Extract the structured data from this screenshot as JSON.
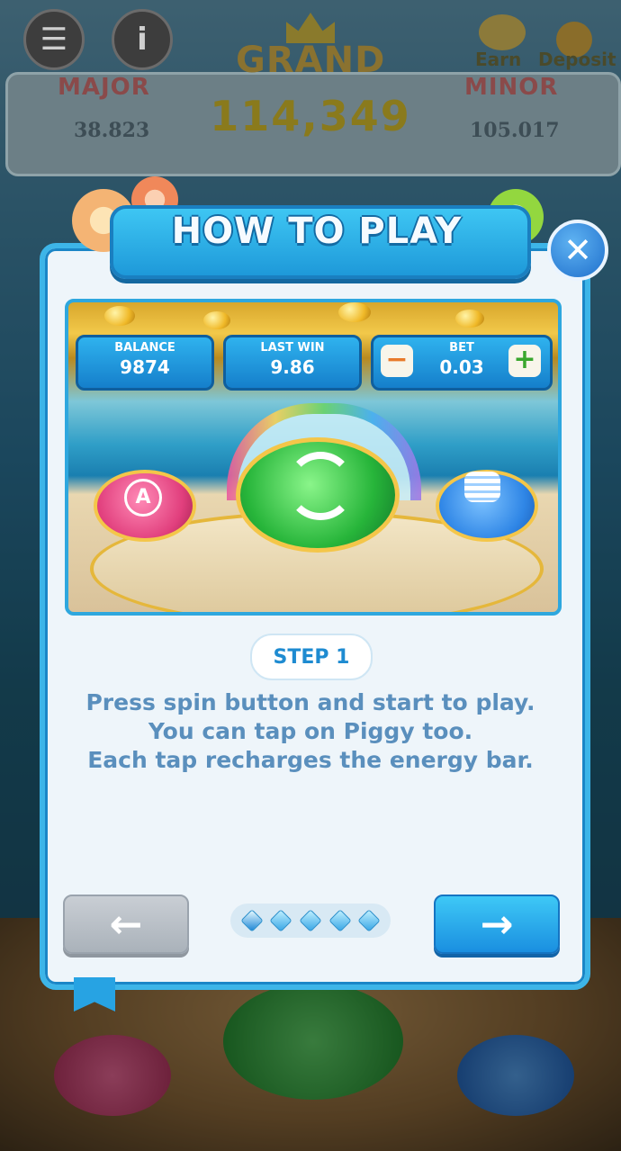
{
  "hud": {
    "menu_icon": "list-icon",
    "info_icon": "info-icon",
    "earn_label": "Earn",
    "deposit_label": "Deposit"
  },
  "jackpots": {
    "grand_label": "GRAND",
    "grand_value": "114,349",
    "major_label": "MAJOR",
    "major_value": "38.823",
    "minor_label": "MINOR",
    "minor_value": "105.017"
  },
  "modal": {
    "title": "HOW TO PLAY",
    "close_icon": "close-icon",
    "preview": {
      "balance_label": "BALANCE",
      "balance_value": "9874",
      "last_win_label": "LAST WIN",
      "last_win_value": "9.86",
      "bet_label": "BET",
      "bet_value": "0.03",
      "bet_minus": "−",
      "bet_plus": "+"
    },
    "step_label": "STEP 1",
    "description": [
      "Press spin button and start to play.",
      "You can tap on Piggy too.",
      "Each tap recharges the energy bar."
    ],
    "prev_icon": "arrow-left-icon",
    "next_icon": "arrow-right-icon",
    "prev_arrow": "←",
    "next_arrow": "→",
    "page_count": 5,
    "current_page": 1
  },
  "colors": {
    "accent": "#1e99d9",
    "title_text": "#f6fbff",
    "description_text": "#5a8fbd",
    "step_text": "#1e8bd1"
  }
}
